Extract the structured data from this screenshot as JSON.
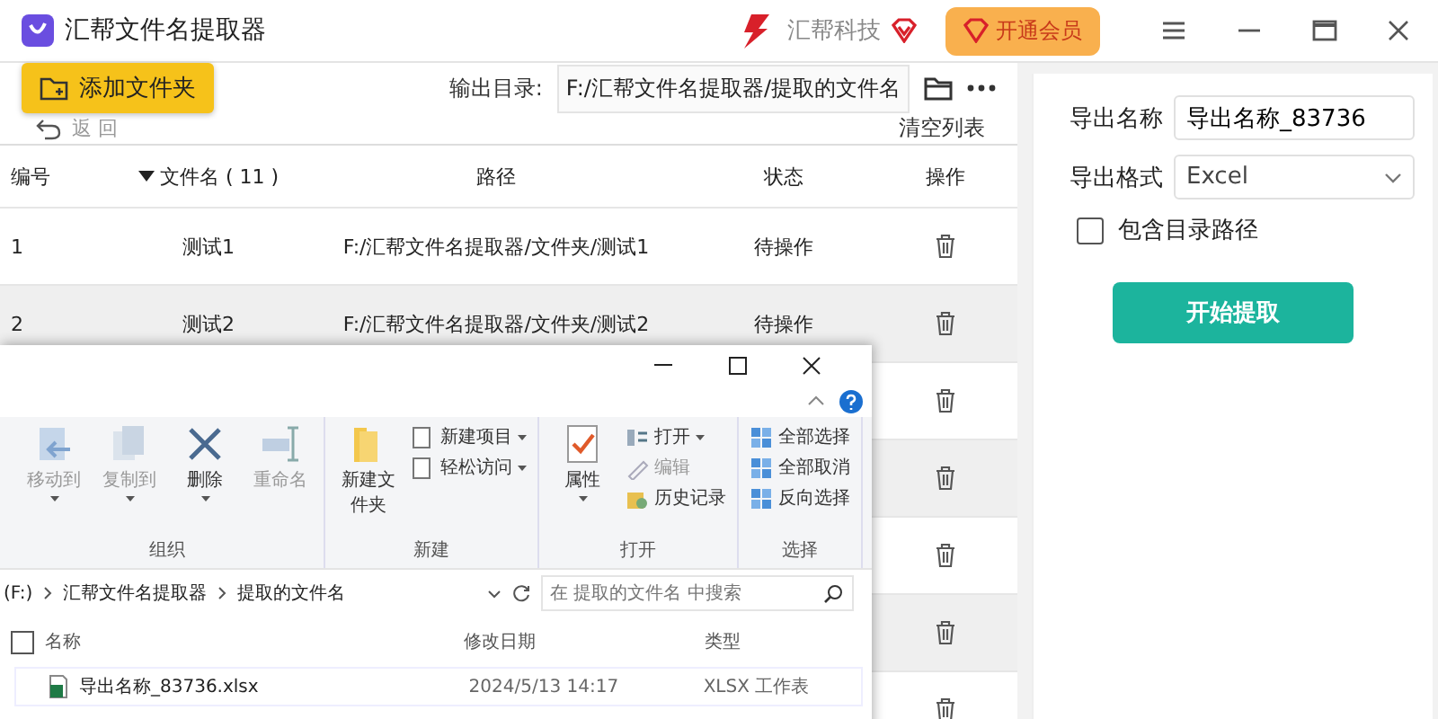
{
  "app": {
    "title": "汇帮文件名提取器",
    "brand": "汇帮科技",
    "vip_button": "开通会员"
  },
  "toolbar": {
    "add_folder": "添加文件夹",
    "output_label": "输出目录:",
    "output_path": "F:/汇帮文件名提取器/提取的文件名",
    "back": "返 回",
    "clear": "清空列表"
  },
  "table": {
    "columns": [
      {
        "label": "编号",
        "sorted": false
      },
      {
        "label": "文件名 ( 11 )",
        "sorted": true
      },
      {
        "label": "路径",
        "sorted": false
      },
      {
        "label": "状态",
        "sorted": false
      },
      {
        "label": "操作",
        "sorted": false
      }
    ],
    "rows": [
      {
        "cells": [
          "1",
          "测试1",
          "F:/汇帮文件名提取器/文件夹/测试1",
          "待操作"
        ]
      },
      {
        "cells": [
          "2",
          "测试2",
          "F:/汇帮文件名提取器/文件夹/测试2",
          "待操作"
        ]
      },
      {},
      {},
      {},
      {},
      {}
    ]
  },
  "export": {
    "name_label": "导出名称",
    "name_value": "导出名称_83736",
    "format_label": "导出格式",
    "format_value": "Excel",
    "include_path": {
      "label": "包含目录路径",
      "checked": false
    },
    "start_button": "开始提取"
  },
  "explorer": {
    "ribbon_groups": [
      {
        "label": "组织",
        "items": [
          {
            "kind": "large",
            "label": "移动到",
            "disabled": true,
            "dropdown": true
          },
          {
            "kind": "large",
            "label": "复制到",
            "disabled": true,
            "dropdown": true
          },
          {
            "kind": "large",
            "label": "删除",
            "disabled": false,
            "dropdown": true
          },
          {
            "kind": "large",
            "label": "重命名",
            "disabled": true,
            "dropdown": false
          }
        ]
      },
      {
        "label": "新建",
        "items": [
          {
            "kind": "large",
            "label": "新建文件夹",
            "disabled": false,
            "dropdown": false
          },
          {
            "kind": "small",
            "label": "新建项目",
            "disabled": false,
            "dropdown": true
          },
          {
            "kind": "small",
            "label": "轻松访问",
            "disabled": false,
            "dropdown": true
          }
        ]
      },
      {
        "label": "打开",
        "items": [
          {
            "kind": "large",
            "label": "属性",
            "disabled": false,
            "dropdown": true
          },
          {
            "kind": "small",
            "label": "打开",
            "disabled": false,
            "dropdown": true
          },
          {
            "kind": "small",
            "label": "编辑",
            "disabled": true,
            "dropdown": false
          },
          {
            "kind": "small",
            "label": "历史记录",
            "disabled": false,
            "dropdown": false
          }
        ]
      },
      {
        "label": "选择",
        "items": [
          {
            "kind": "small",
            "label": "全部选择",
            "disabled": false,
            "dropdown": false
          },
          {
            "kind": "small",
            "label": "全部取消",
            "disabled": false,
            "dropdown": false
          },
          {
            "kind": "small",
            "label": "反向选择",
            "disabled": false,
            "dropdown": false
          }
        ]
      }
    ],
    "address": [
      "(F:)",
      "汇帮文件名提取器",
      "提取的文件名"
    ],
    "search_placeholder": "在 提取的文件名 中搜索",
    "select_all": {
      "checked": false
    },
    "columns": [
      "名称",
      "修改日期",
      "类型"
    ],
    "files": [
      {
        "name": "导出名称_83736.xlsx",
        "date": "2024/5/13 14:17",
        "type": "XLSX 工作表"
      }
    ]
  }
}
